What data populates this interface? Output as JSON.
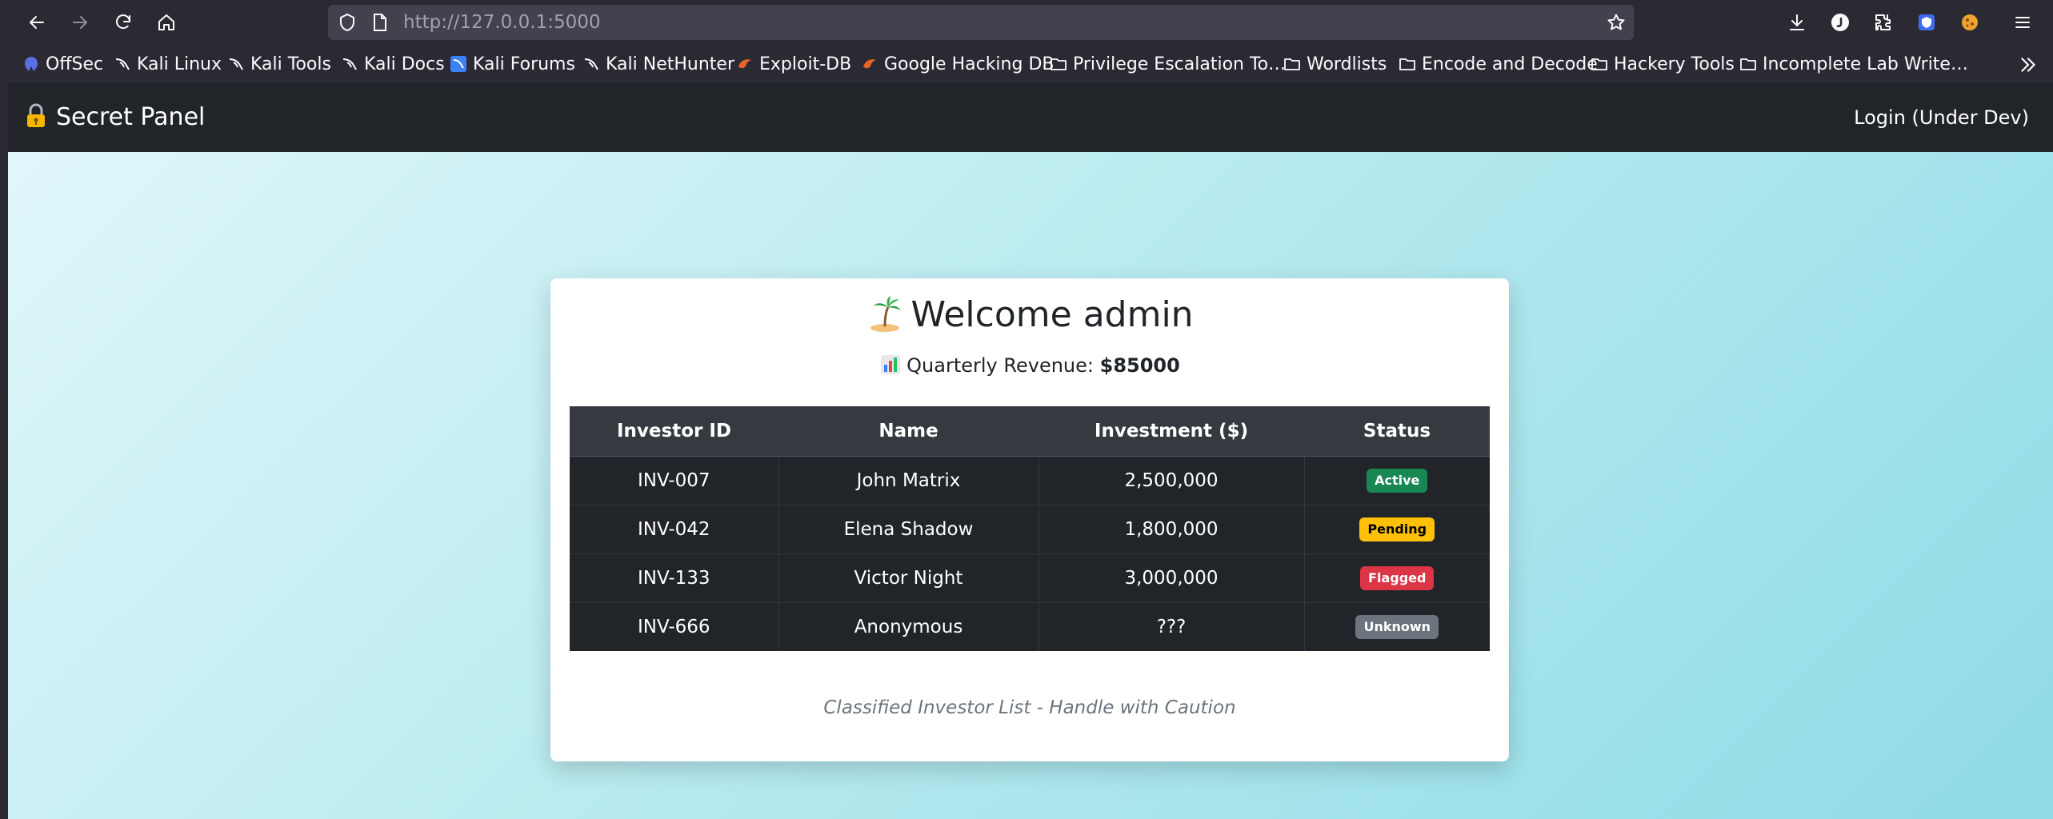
{
  "browser": {
    "url_host": "http://127.0.0.1",
    "url_port": ":5000",
    "bookmarks": [
      {
        "label": "OffSec",
        "icon": "offsec-icon"
      },
      {
        "label": "Kali Linux",
        "icon": "kali-dragon-icon"
      },
      {
        "label": "Kali Tools",
        "icon": "kali-dragon-icon"
      },
      {
        "label": "Kali Docs",
        "icon": "kali-dragon-icon"
      },
      {
        "label": "Kali Forums",
        "icon": "kali-forums-icon"
      },
      {
        "label": "Kali NetHunter",
        "icon": "kali-dragon-icon"
      },
      {
        "label": "Exploit-DB",
        "icon": "exploitdb-icon"
      },
      {
        "label": "Google Hacking DB",
        "icon": "exploitdb-icon"
      },
      {
        "label": "Privilege Escalation To…",
        "icon": "folder-icon"
      },
      {
        "label": "Wordlists",
        "icon": "folder-icon"
      },
      {
        "label": "Encode and Decode",
        "icon": "folder-icon"
      },
      {
        "label": "Hackery Tools",
        "icon": "folder-icon"
      },
      {
        "label": "Incomplete Lab Write…",
        "icon": "folder-icon"
      }
    ]
  },
  "navbar": {
    "brand": "Secret Panel",
    "brand_icon": "lock-key-icon",
    "login": "Login (Under Dev)"
  },
  "card": {
    "welcome": "Welcome admin",
    "revenue_label": "Quarterly Revenue:",
    "revenue_value": "$85000",
    "table": {
      "headers": [
        "Investor ID",
        "Name",
        "Investment ($)",
        "Status"
      ],
      "rows": [
        {
          "id": "INV-007",
          "name": "John Matrix",
          "investment": "2,500,000",
          "status": "Active",
          "status_color": "#198754"
        },
        {
          "id": "INV-042",
          "name": "Elena Shadow",
          "investment": "1,800,000",
          "status": "Pending",
          "status_color": "#ffc107"
        },
        {
          "id": "INV-133",
          "name": "Victor Night",
          "investment": "3,000,000",
          "status": "Flagged",
          "status_color": "#dc3545"
        },
        {
          "id": "INV-666",
          "name": "Anonymous",
          "investment": "???",
          "status": "Unknown",
          "status_color": "#6c757d"
        }
      ]
    },
    "caption": "Classified Investor List - Handle with Caution"
  }
}
